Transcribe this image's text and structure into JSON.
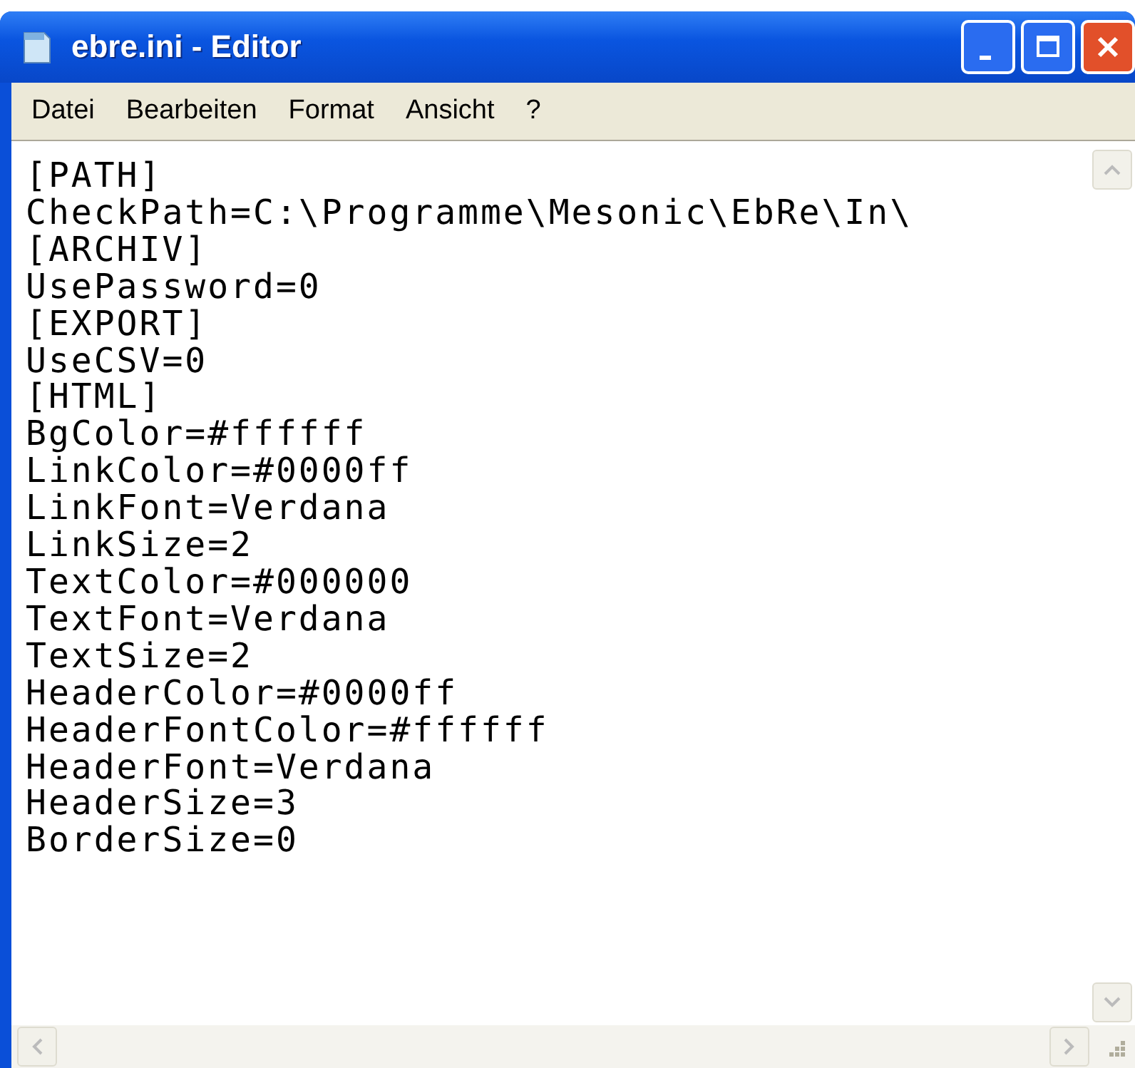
{
  "window": {
    "title": "ebre.ini - Editor"
  },
  "menu": [
    "Datei",
    "Bearbeiten",
    "Format",
    "Ansicht",
    "?"
  ],
  "lines": [
    "[PATH]",
    "CheckPath=C:\\Programme\\Mesonic\\EbRe\\In\\",
    "[ARCHIV]",
    "UsePassword=0",
    "[EXPORT]",
    "UseCSV=0",
    "[HTML]",
    "BgColor=#ffffff",
    "LinkColor=#0000ff",
    "LinkFont=Verdana",
    "LinkSize=2",
    "TextColor=#000000",
    "TextFont=Verdana",
    "TextSize=2",
    "HeaderColor=#0000ff",
    "HeaderFontColor=#ffffff",
    "HeaderFont=Verdana",
    "HeaderSize=3",
    "BorderSize=0"
  ]
}
